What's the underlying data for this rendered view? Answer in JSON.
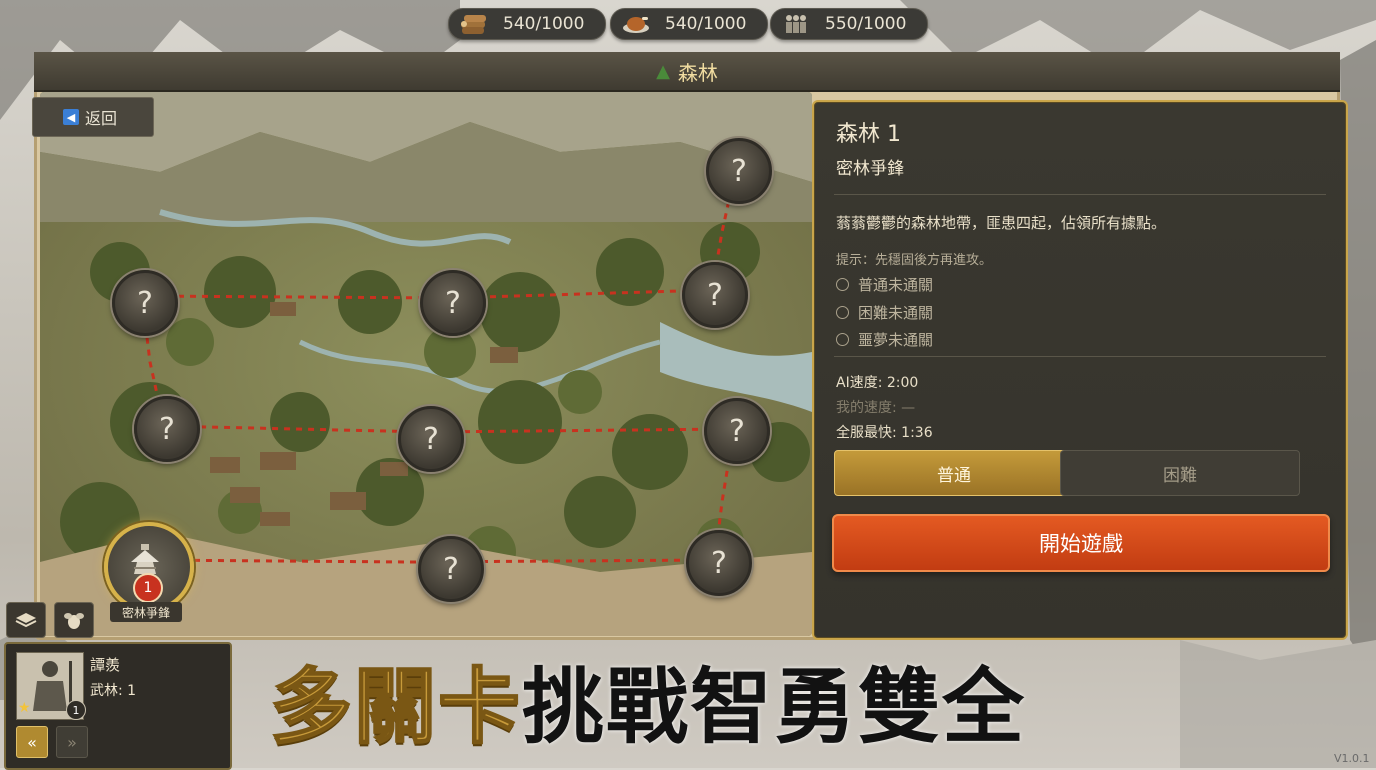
{
  "resources": [
    {
      "icon": "wood-icon",
      "value": "540/1000"
    },
    {
      "icon": "food-icon",
      "value": "540/1000"
    },
    {
      "icon": "soldiers-icon",
      "value": "550/1000"
    }
  ],
  "header": {
    "title": "森林"
  },
  "back_label": "返回",
  "map": {
    "current_node": {
      "badge": "1",
      "label": "密林爭鋒"
    },
    "locked_symbol": "?"
  },
  "panel": {
    "title": "森林 1",
    "subtitle": "密林爭鋒",
    "description": "蓊蓊鬱鬱的森林地帶，匪患四起，佔領所有據點。",
    "tip": "提示：先穩固後方再進攻。",
    "conditions": [
      "普通未通關",
      "困難未通關",
      "噩夢未通關"
    ],
    "ai_speed": "AI速度: 2:00",
    "my_speed": "我的速度: —",
    "server_best": "全服最快: 1:36",
    "difficulty": {
      "normal": "普通",
      "hard": "困難"
    },
    "start_label": "開始遊戲"
  },
  "hero": {
    "name": "譚羨",
    "level_text": "武林: 1",
    "badge": "1"
  },
  "slogan": {
    "gold": "多關卡",
    "black": "挑戰智勇雙全"
  },
  "version": "V1.0.1",
  "colors": {
    "accent_gold": "#c9a54a",
    "start_orange": "#d84a1a",
    "route_red": "#c8321f"
  }
}
